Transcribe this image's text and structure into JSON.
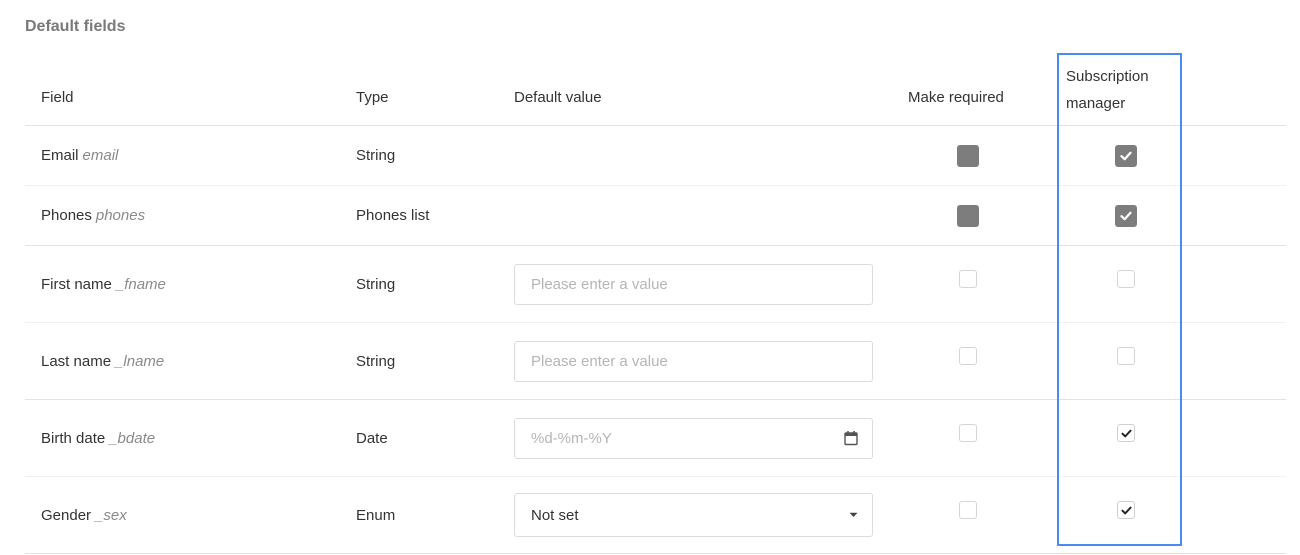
{
  "section": {
    "title": "Default fields"
  },
  "table": {
    "headers": {
      "field": "Field",
      "type": "Type",
      "default_value": "Default value",
      "make_required": "Make required",
      "subscription_manager_line1": "Subscription",
      "subscription_manager_line2": "manager"
    },
    "rows": [
      {
        "name": "Email",
        "key": "email",
        "type": "String",
        "make_required": "locked",
        "subscription_manager": "locked-checked"
      },
      {
        "name": "Phones",
        "key": "phones",
        "type": "Phones list",
        "make_required": "locked",
        "subscription_manager": "locked-checked"
      },
      {
        "name": "First name",
        "key": "_fname",
        "type": "String",
        "default_placeholder": "Please enter a value",
        "make_required": false,
        "subscription_manager": false
      },
      {
        "name": "Last name",
        "key": "_lname",
        "type": "String",
        "default_placeholder": "Please enter a value",
        "make_required": false,
        "subscription_manager": false
      },
      {
        "name": "Birth date",
        "key": "_bdate",
        "type": "Date",
        "default_placeholder": "%d-%m-%Y",
        "default_icon": "calendar-icon",
        "make_required": false,
        "subscription_manager": true
      },
      {
        "name": "Gender",
        "key": "_sex",
        "type": "Enum",
        "default_selected": "Not set",
        "default_icon": "caret-down-icon",
        "make_required": false,
        "subscription_manager": true
      }
    ]
  },
  "colors": {
    "highlight": "#4a8af4",
    "locked_checkbox": "#7d7d7d"
  }
}
